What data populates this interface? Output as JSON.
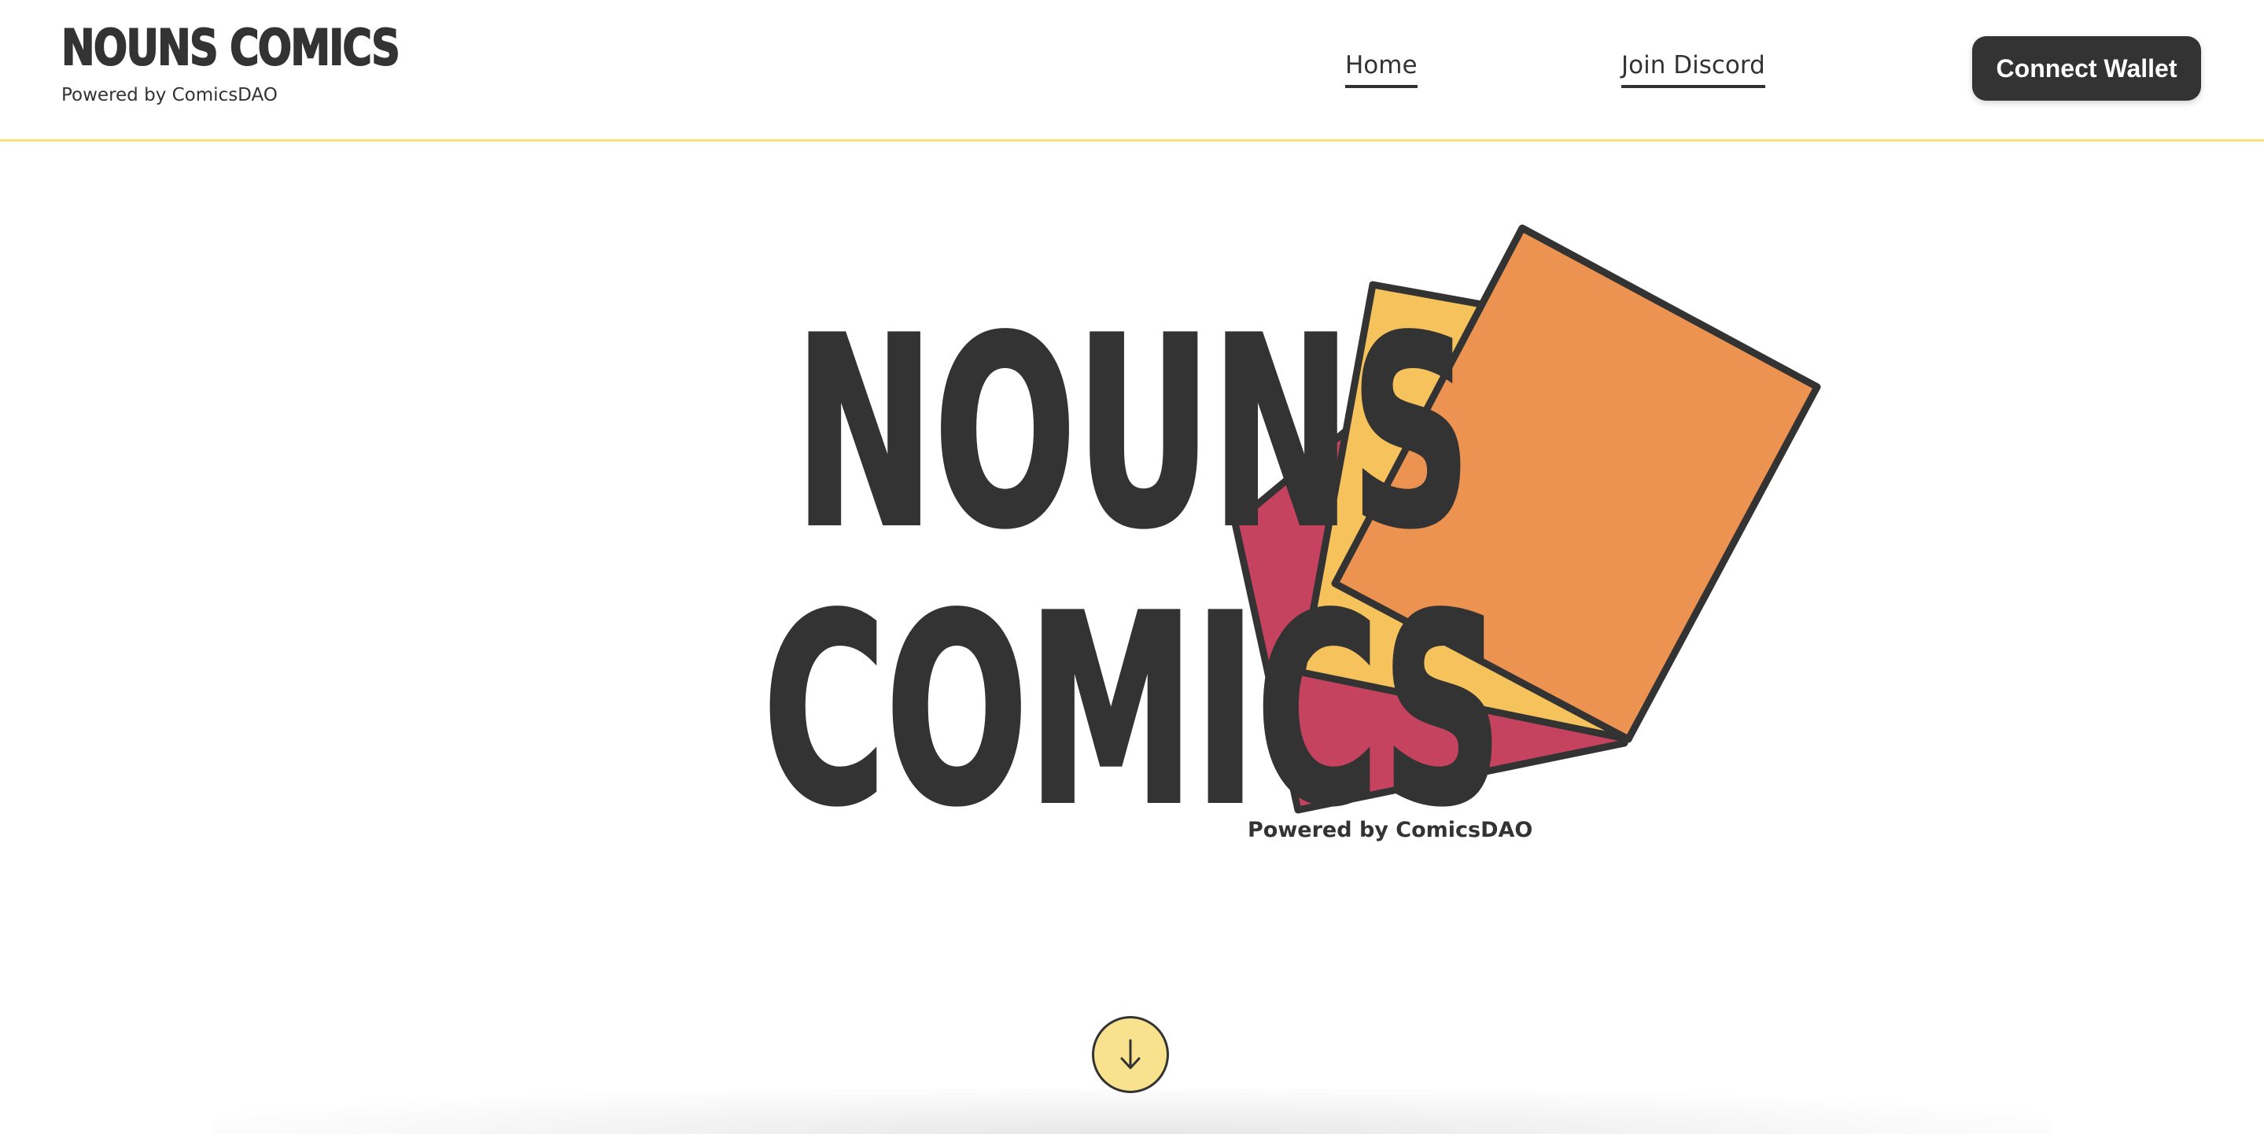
{
  "header": {
    "brand_title": "NOUNS COMICS",
    "brand_subtitle": "Powered by ComicsDAO",
    "nav": {
      "home_label": "Home",
      "discord_label": "Join Discord"
    },
    "connect_wallet_label": "Connect Wallet"
  },
  "hero": {
    "title_line1": "NOUNS",
    "title_line2": "COMICS",
    "subtitle": "Powered by ComicsDAO",
    "logo_card_colors": [
      "#c5435f",
      "#f5c25c",
      "#ec9352"
    ]
  },
  "scroll": {
    "icon": "arrow-down-icon",
    "color": "#f8e28e"
  },
  "colors": {
    "text": "#333333",
    "header_border": "#f6e27c",
    "button_bg": "#333333",
    "button_text": "#ffffff"
  }
}
